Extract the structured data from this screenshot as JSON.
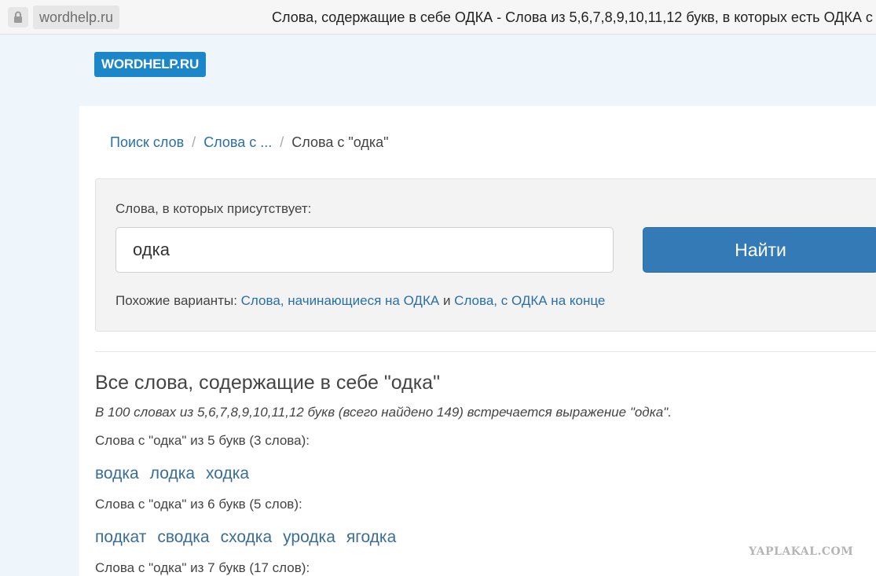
{
  "browser": {
    "url": "wordhelp.ru",
    "title": "Слова, содержащие в себе ОДКА - Слова из 5,6,7,8,9,10,11,12 букв, в которых есть ОДКА с"
  },
  "logo": "WORDHELP.RU",
  "breadcrumb": {
    "items": [
      "Поиск слов",
      "Слова с ..."
    ],
    "current": "Слова с \"одка\""
  },
  "search": {
    "label": "Слова, в которых присутствует:",
    "value": "одка",
    "button": "Найти",
    "similar_prefix": "Похожие варианты:",
    "similar_link1": "Слова, начинающиеся на ОДКА",
    "similar_and": "и",
    "similar_link2": "Слова, с ОДКА на конце"
  },
  "results": {
    "title": "Все слова, содержащие в себе \"одка\"",
    "subtitle": "В 100 словах из 5,6,7,8,9,10,11,12 букв (всего найдено 149) встречается выражение \"одка\".",
    "groups": [
      {
        "heading": "Слова с \"одка\" из 5 букв (3 слова):",
        "words": [
          "водка",
          "лодка",
          "ходка"
        ]
      },
      {
        "heading": "Слова с \"одка\" из 6 букв (5 слов):",
        "words": [
          "подкат",
          "сводка",
          "сходка",
          "уродка",
          "ягодка"
        ]
      },
      {
        "heading": "Слова с \"одка\" из 7 букв (17 слов):",
        "words": []
      }
    ]
  },
  "watermark": "YAPLAKAL.COM"
}
